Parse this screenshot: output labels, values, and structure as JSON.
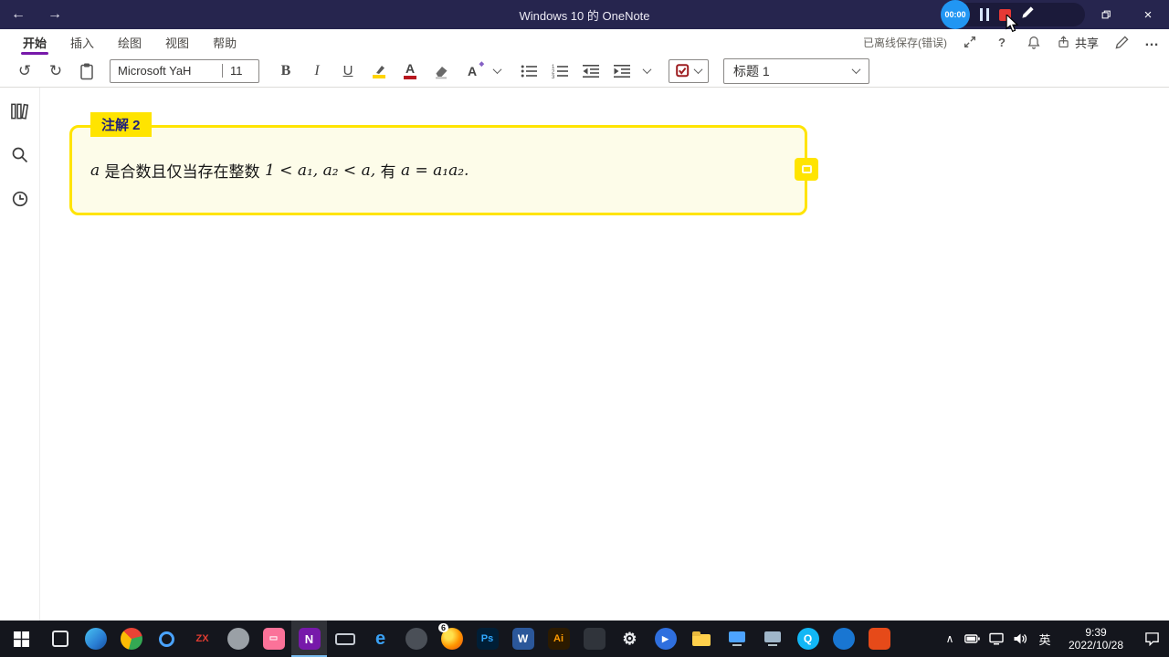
{
  "titlebar": {
    "title": "Windows 10 的 OneNote",
    "back_arrow": "←",
    "forward_arrow": "→",
    "recorder": {
      "timer": "00:00"
    }
  },
  "ribbon": {
    "tabs": [
      {
        "label": "开始",
        "active": true
      },
      {
        "label": "插入",
        "active": false
      },
      {
        "label": "绘图",
        "active": false
      },
      {
        "label": "视图",
        "active": false
      },
      {
        "label": "帮助",
        "active": false
      }
    ],
    "save_status": "已离线保存(错误)",
    "help_label": "?",
    "share_label": "共享",
    "more_label": "…"
  },
  "toolbar": {
    "font_name": "Microsoft YaH",
    "font_size": "11",
    "bold_label": "B",
    "italic_label": "I",
    "underline_label": "U",
    "font_color_label": "A",
    "font_options_label": "A",
    "font_options_mark": "◆",
    "style_name": "标题 1"
  },
  "note": {
    "tag": "注解 2",
    "segments": [
      {
        "text": "a",
        "italic": true
      },
      {
        "text": " 是合数且仅当存在整数 ",
        "italic": false
      },
      {
        "text": "1 < a₁, a₂ < a,",
        "italic": true
      },
      {
        "text": " 有 ",
        "italic": false
      },
      {
        "text": "a = a₁a₂.",
        "italic": true
      }
    ]
  },
  "taskbar": {
    "apps": [
      {
        "name": "task-view",
        "shape": "outline",
        "glyph": ""
      },
      {
        "name": "edge",
        "shape": "circle",
        "bg": "linear-gradient(135deg,#49c3f2 0%,#2a7fd4 60%,#174e9e 100%)",
        "glyph": ""
      },
      {
        "name": "chrome",
        "shape": "circle",
        "bg": "conic-gradient(from -45deg,#ea4335 0 120deg,#34a853 120deg 240deg,#fbbc05 240deg 360deg)",
        "glyph": ""
      },
      {
        "name": "browser-ring",
        "shape": "ring",
        "glyph": ""
      },
      {
        "name": "zx-app",
        "shape": "none",
        "glyph": "ZX",
        "fg": "#e03c31",
        "fs": 11
      },
      {
        "name": "gray-app",
        "shape": "circle",
        "bg": "#9aa0a6",
        "glyph": ""
      },
      {
        "name": "bilibili",
        "shape": "square",
        "bg": "#fb7299",
        "glyph": "▭",
        "fg": "#ffffff",
        "fs": 10
      },
      {
        "name": "onenote",
        "shape": "square",
        "bg": "#7719aa",
        "glyph": "N",
        "fg": "#ffffff",
        "fs": 13,
        "active": true
      },
      {
        "name": "keyboard",
        "shape": "kbd",
        "glyph": ""
      },
      {
        "name": "edge-classic",
        "shape": "none",
        "glyph": "e",
        "fg": "#3aa0f3",
        "fs": 20
      },
      {
        "name": "dark-app",
        "shape": "circle",
        "bg": "#4a4f57",
        "glyph": ""
      },
      {
        "name": "firefox",
        "shape": "circle",
        "bg": "radial-gradient(circle at 35% 35%,#ffe14d 0 20%,#ff9500 55%,#e64a19 100%)",
        "glyph": "",
        "badge": "6"
      },
      {
        "name": "photoshop",
        "shape": "square",
        "bg": "#001e36",
        "glyph": "Ps",
        "fg": "#31a8ff",
        "fs": 11
      },
      {
        "name": "word",
        "shape": "square",
        "bg": "#2b579a",
        "glyph": "W",
        "fg": "#ffffff",
        "fs": 12
      },
      {
        "name": "illustrator",
        "shape": "square",
        "bg": "#2b1a00",
        "glyph": "Ai",
        "fg": "#ff9a00",
        "fs": 11
      },
      {
        "name": "dark-app-2",
        "shape": "square",
        "bg": "#30343b",
        "glyph": ""
      },
      {
        "name": "settings",
        "shape": "none",
        "glyph": "⚙",
        "fg": "#e8eaed",
        "fs": 18
      },
      {
        "name": "media-player",
        "shape": "circle",
        "bg": "#2f6fde",
        "glyph": "▶",
        "fg": "#ffffff",
        "fs": 9
      },
      {
        "name": "file-explorer",
        "shape": "folder",
        "glyph": ""
      },
      {
        "name": "monitor-blue",
        "shape": "monitor",
        "color": "#4da3ff",
        "glyph": ""
      },
      {
        "name": "monitor-gray",
        "shape": "monitor",
        "color": "#9fb6c9",
        "glyph": ""
      },
      {
        "name": "qq-browser",
        "shape": "circle",
        "bg": "#12b7f5",
        "glyph": "Q",
        "fg": "#ffffff",
        "fs": 12
      },
      {
        "name": "blue-app",
        "shape": "circle",
        "bg": "#1976d2",
        "glyph": ""
      },
      {
        "name": "orange-app",
        "shape": "square",
        "bg": "#e64a19",
        "glyph": ""
      }
    ],
    "tray": {
      "hidden_icons": "∧",
      "lang": "英",
      "time": "9:39",
      "date": "2022/10/28"
    }
  }
}
